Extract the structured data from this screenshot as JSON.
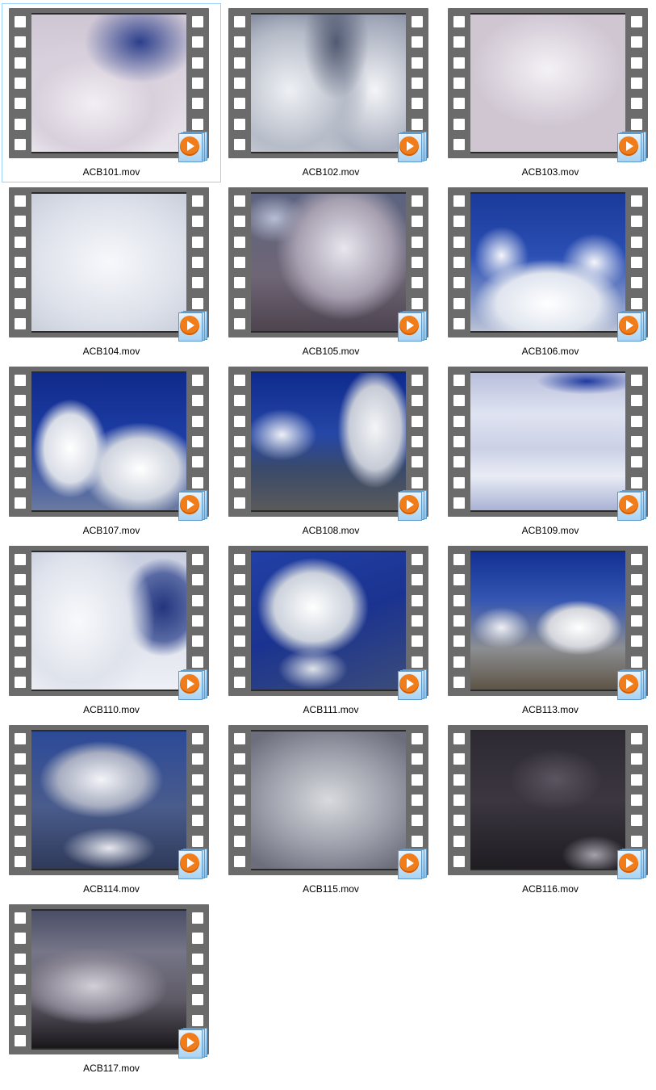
{
  "files": [
    {
      "name": "ACB101.mov",
      "scene": "c-bright",
      "selected": true
    },
    {
      "name": "ACB102.mov",
      "scene": "c-split",
      "selected": false
    },
    {
      "name": "ACB103.mov",
      "scene": "c-fog",
      "selected": false
    },
    {
      "name": "ACB104.mov",
      "scene": "c-white",
      "selected": false
    },
    {
      "name": "ACB105.mov",
      "scene": "c-dusk",
      "selected": false
    },
    {
      "name": "ACB106.mov",
      "scene": "c-bluesky",
      "selected": false
    },
    {
      "name": "ACB107.mov",
      "scene": "c-bluesky2",
      "selected": false
    },
    {
      "name": "ACB108.mov",
      "scene": "c-bluesky3",
      "selected": false
    },
    {
      "name": "ACB109.mov",
      "scene": "c-haze",
      "selected": false
    },
    {
      "name": "ACB110.mov",
      "scene": "c-haze2",
      "selected": false
    },
    {
      "name": "ACB111.mov",
      "scene": "c-tilt",
      "selected": false
    },
    {
      "name": "ACB113.mov",
      "scene": "c-land",
      "selected": false
    },
    {
      "name": "ACB114.mov",
      "scene": "c-storm",
      "selected": false
    },
    {
      "name": "ACB115.mov",
      "scene": "c-grey",
      "selected": false
    },
    {
      "name": "ACB116.mov",
      "scene": "c-dark",
      "selected": false
    },
    {
      "name": "ACB117.mov",
      "scene": "c-dark2",
      "selected": false
    }
  ],
  "icons": {
    "file_type": "media-player-play-icon",
    "film": "filmstrip-thumbnail"
  },
  "colors": {
    "selection_border": "#99d1ff",
    "play_orange": "#f07c1a",
    "film_grey": "#6b6b6b"
  }
}
